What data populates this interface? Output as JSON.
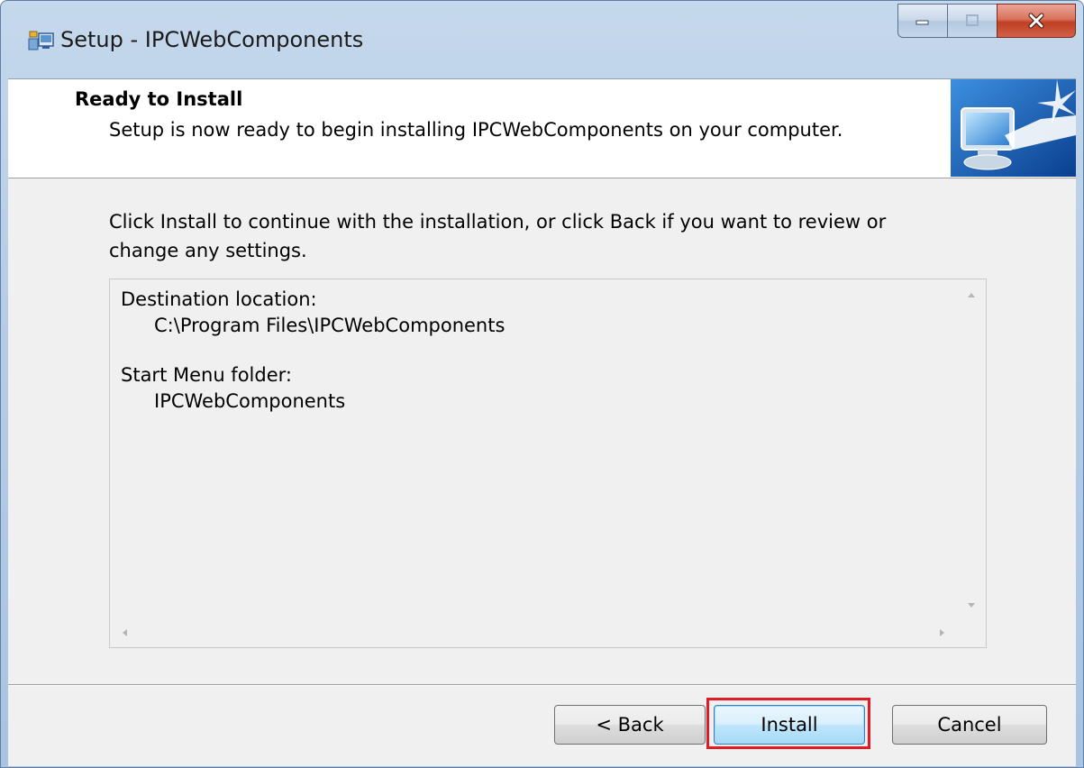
{
  "window": {
    "title": "Setup - IPCWebComponents",
    "caption_buttons": {
      "minimize_icon": "minimize-icon",
      "maximize_icon": "maximize-icon",
      "close_icon": "close-icon"
    }
  },
  "header": {
    "title": "Ready to Install",
    "subtitle": "Setup is now ready to begin installing IPCWebComponents on your computer.",
    "image_icon": "computer-install-icon"
  },
  "body": {
    "instructions": "Click Install to continue with the installation, or click Back if you want to review or change any settings."
  },
  "memo": {
    "destination_label": "Destination location:",
    "destination_value": "C:\\Program Files\\IPCWebComponents",
    "start_menu_label": "Start Menu folder:",
    "start_menu_value": "IPCWebComponents"
  },
  "buttons": {
    "back": "< Back",
    "install": "Install",
    "cancel": "Cancel"
  },
  "colors": {
    "highlight": "#e01b24",
    "close_button": "#c13f22",
    "accent_blue": "#3c7fb1"
  }
}
